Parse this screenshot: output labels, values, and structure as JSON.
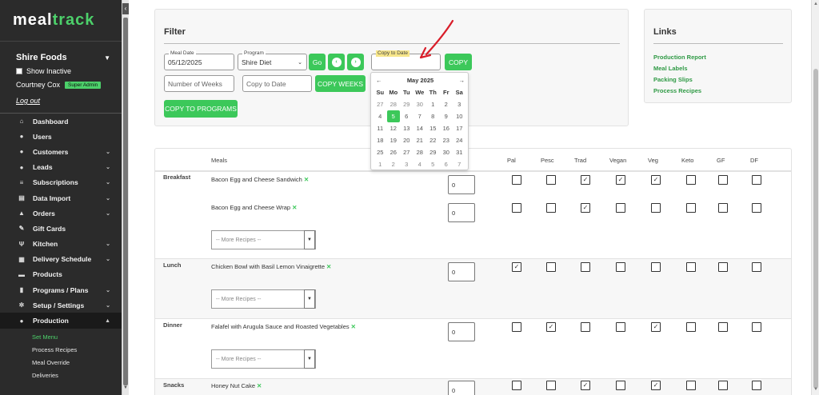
{
  "brand": {
    "part1": "meal",
    "part2": "track"
  },
  "sidebar": {
    "org_name": "Shire Foods",
    "show_inactive": "Show Inactive",
    "user_name": "Courtney Cox",
    "role_badge": "Super Admin",
    "logout": "Log out",
    "items": [
      {
        "label": "Dashboard",
        "icon": "home-icon",
        "expandable": false
      },
      {
        "label": "Users",
        "icon": "user-icon",
        "expandable": false
      },
      {
        "label": "Customers",
        "icon": "users-icon",
        "expandable": true
      },
      {
        "label": "Leads",
        "icon": "info-icon",
        "expandable": true
      },
      {
        "label": "Subscriptions",
        "icon": "layers-icon",
        "expandable": true
      },
      {
        "label": "Data Import",
        "icon": "file-icon",
        "expandable": true
      },
      {
        "label": "Orders",
        "icon": "bag-icon",
        "expandable": true
      },
      {
        "label": "Gift Cards",
        "icon": "wrench-icon",
        "expandable": false
      },
      {
        "label": "Kitchen",
        "icon": "utensils-icon",
        "expandable": true
      },
      {
        "label": "Delivery Schedule",
        "icon": "calendar-icon",
        "expandable": true
      },
      {
        "label": "Products",
        "icon": "box-icon",
        "expandable": false
      },
      {
        "label": "Programs / Plans",
        "icon": "clipboard-icon",
        "expandable": true
      },
      {
        "label": "Setup / Settings",
        "icon": "gear-icon",
        "expandable": true
      },
      {
        "label": "Production",
        "icon": "user-icon",
        "expandable": true,
        "active": true
      }
    ],
    "sub_items": [
      {
        "label": "Set Menu",
        "active": true
      },
      {
        "label": "Process Recipes"
      },
      {
        "label": "Meal Override"
      },
      {
        "label": "Deliveries"
      }
    ]
  },
  "filter": {
    "title": "Filter",
    "meal_date_label": "Meal Date",
    "meal_date_value": "05/12/2025",
    "program_label": "Program",
    "program_value": "Shire Diet",
    "go_label": "Go",
    "copy_to_date_label": "Copy to Date",
    "copy_label": "COPY",
    "num_weeks_placeholder": "Number of Weeks",
    "copy_to_date_placeholder": "Copy to Date",
    "copy_weeks_label": "COPY WEEKS",
    "copy_programs_label": "COPY TO PROGRAMS"
  },
  "datepicker": {
    "month_label": "May 2025",
    "prev": "←",
    "next": "→",
    "weekdays": [
      "Su",
      "Mo",
      "Tu",
      "We",
      "Th",
      "Fr",
      "Sa"
    ],
    "weeks": [
      [
        "27",
        "28",
        "29",
        "30",
        "1",
        "2",
        "3"
      ],
      [
        "4",
        "5",
        "6",
        "7",
        "8",
        "9",
        "10"
      ],
      [
        "11",
        "12",
        "13",
        "14",
        "15",
        "16",
        "17"
      ],
      [
        "18",
        "19",
        "20",
        "21",
        "22",
        "23",
        "24"
      ],
      [
        "25",
        "26",
        "27",
        "28",
        "29",
        "30",
        "31"
      ],
      [
        "1",
        "2",
        "3",
        "4",
        "5",
        "6",
        "7"
      ]
    ],
    "selected": "5",
    "accent": "#3cc85a"
  },
  "links": {
    "title": "Links",
    "items": [
      "Production Report",
      "Meal Labels",
      "Packing Slips",
      "Process Recipes"
    ]
  },
  "meals_table": {
    "header_meals": "Meals",
    "diet_columns": [
      "Pal",
      "Pesc",
      "Trad",
      "Vegan",
      "Veg",
      "Keto",
      "GF",
      "DF"
    ],
    "more_placeholder": "-- More Recipes --",
    "rows": [
      {
        "meal": "Breakfast",
        "recipe": "Bacon Egg and Cheese Sandwich",
        "qty": "0",
        "checks": [
          false,
          false,
          true,
          true,
          true,
          false,
          false,
          false
        ]
      },
      {
        "meal": "",
        "recipe": "Bacon Egg and Cheese Wrap",
        "qty": "0",
        "checks": [
          false,
          false,
          true,
          false,
          false,
          false,
          false,
          false
        ]
      },
      {
        "meal": "Lunch",
        "recipe": "Chicken Bowl with Basil Lemon Vinaigrette",
        "qty": "0",
        "checks": [
          true,
          false,
          false,
          false,
          false,
          false,
          false,
          false
        ]
      },
      {
        "meal": "Dinner",
        "recipe": "Falafel with Arugula Sauce and Roasted Vegetables",
        "qty": "0",
        "checks": [
          false,
          true,
          false,
          false,
          true,
          false,
          false,
          false
        ]
      },
      {
        "meal": "Snacks",
        "recipe": "Honey Nut Cake",
        "qty": "0",
        "checks": [
          false,
          false,
          true,
          false,
          true,
          false,
          false,
          false
        ]
      }
    ]
  }
}
